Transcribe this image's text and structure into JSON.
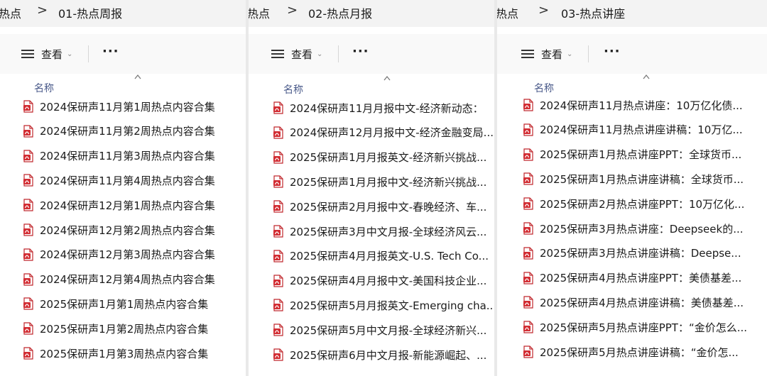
{
  "panes": [
    {
      "breadcrumb": {
        "parent": "热点",
        "separator": ">",
        "current": "01-热点周报"
      },
      "toolbar": {
        "view_label": "查看",
        "more": "···"
      },
      "column_header": "名称",
      "files": [
        "2024保研声11月第1周热点内容合集",
        "2024保研声11月第2周热点内容合集",
        "2024保研声11月第3周热点内容合集",
        "2024保研声11月第4周热点内容合集",
        "2024保研声12月第1周热点内容合集",
        "2024保研声12月第2周热点内容合集",
        "2024保研声12月第3周热点内容合集",
        "2024保研声12月第4周热点内容合集",
        "2025保研声1月第1周热点内容合集",
        "2025保研声1月第2周热点内容合集",
        "2025保研声1月第3周热点内容合集"
      ]
    },
    {
      "breadcrumb": {
        "parent": "热点",
        "separator": ">",
        "current": "02-热点月报"
      },
      "toolbar": {
        "view_label": "查看",
        "more": "···"
      },
      "column_header": "名称",
      "files": [
        "2024保研声11月月报中文-经济新动态：",
        "2024保研声12月月报中文-经济金融变局...",
        "2025保研声1月月报英文-经济新兴挑战...",
        "2025保研声1月月报中文-经济新兴挑战...",
        "2025保研声2月月报中文-春晚经济、车...",
        "2025保研声3月中文月报-全球经济风云...",
        "2025保研声4月月报英文-U.S. Tech Co...",
        "2025保研声4月月报中文-美国科技企业...",
        "2025保研声5月月报英文-Emerging cha...",
        "2025保研声5月中文月报-全球经济新兴...",
        "2025保研声6月中文月报-新能源崛起、..."
      ]
    },
    {
      "breadcrumb": {
        "parent": "热点",
        "separator": ">",
        "current": "03-热点讲座"
      },
      "toolbar": {
        "view_label": "查看",
        "more": "···"
      },
      "column_header": "名称",
      "files": [
        "2024保研声11月热点讲座：10万亿化债...",
        "2024保研声11月热点讲座讲稿：10万亿...",
        "2025保研声1月热点讲座PPT：全球货币...",
        "2025保研声1月热点讲座讲稿：全球货币...",
        "2025保研声2月热点讲座PPT：10万亿化...",
        "2025保研声3月热点讲座：Deepseek的...",
        "2025保研声3月热点讲座讲稿：Deepse...",
        "2025保研声4月热点讲座PPT：美债基差...",
        "2025保研声4月热点讲座讲稿：美债基差...",
        "2025保研声5月热点讲座PPT：“金价怎么...",
        "2025保研声5月热点讲座讲稿：“金价怎..."
      ]
    }
  ]
}
